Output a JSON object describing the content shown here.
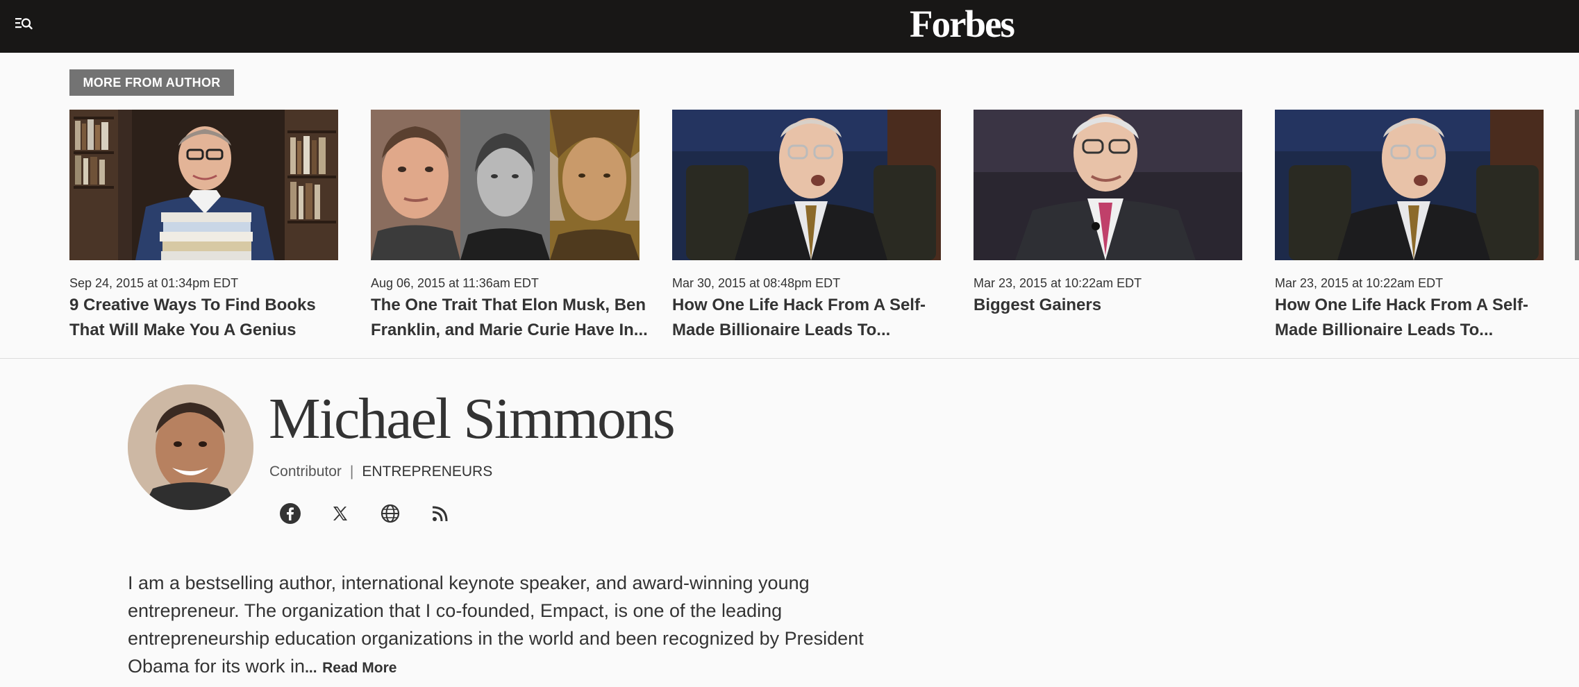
{
  "header": {
    "brand": "Forbes",
    "menu_icon": "menu-search-icon"
  },
  "more_from_author": {
    "label": "MORE FROM AUTHOR",
    "articles": [
      {
        "date": "Sep 24, 2015 at 01:34pm EDT",
        "title": "9 Creative Ways To Find Books That Will Make You A Genius"
      },
      {
        "date": "Aug 06, 2015 at 11:36am EDT",
        "title": "The One Trait That Elon Musk, Ben Franklin, and Marie Curie Have In..."
      },
      {
        "date": "Mar 30, 2015 at 08:48pm EDT",
        "title": "How One Life Hack From A Self-Made Billionaire Leads To..."
      },
      {
        "date": "Mar 23, 2015 at 10:22am EDT",
        "title": "Biggest Gainers"
      },
      {
        "date": "Mar 23, 2015 at 10:22am EDT",
        "title": "How One Life Hack From A Self-Made Billionaire Leads To..."
      }
    ]
  },
  "author": {
    "name": "Michael Simmons",
    "role": "Contributor",
    "separator": "|",
    "section": "ENTREPRENEURS",
    "socials": [
      "facebook-icon",
      "x-icon",
      "globe-icon",
      "rss-icon"
    ],
    "bio": "I am a bestselling author, international keynote speaker, and award-winning young entrepreneur. The organization that I co-founded, Empact, is one of the leading entrepreneurship education organizations in the world and been recognized by President Obama for its work in",
    "ellipsis": "...",
    "read_more": "Read More"
  }
}
